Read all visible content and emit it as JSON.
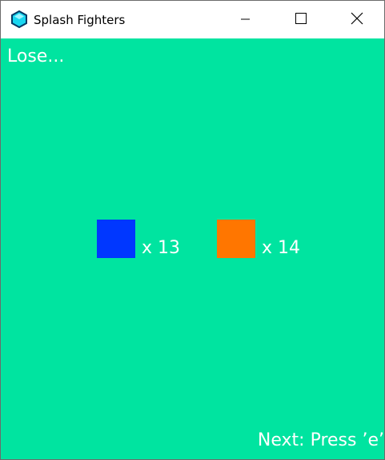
{
  "window": {
    "title": "Splash Fighters",
    "icon": "cyan-gem-icon",
    "controls": {
      "minimize": "minimize-icon",
      "maximize": "maximize-icon",
      "close": "close-icon"
    }
  },
  "game": {
    "background_color": "#00e4a0",
    "status": "Lose...",
    "players": [
      {
        "color": "#0037ff",
        "score_label": "x 13",
        "score": 13
      },
      {
        "color": "#ff7600",
        "score_label": "x 14",
        "score": 14
      }
    ],
    "prompt": "Next: Press ’e’"
  }
}
